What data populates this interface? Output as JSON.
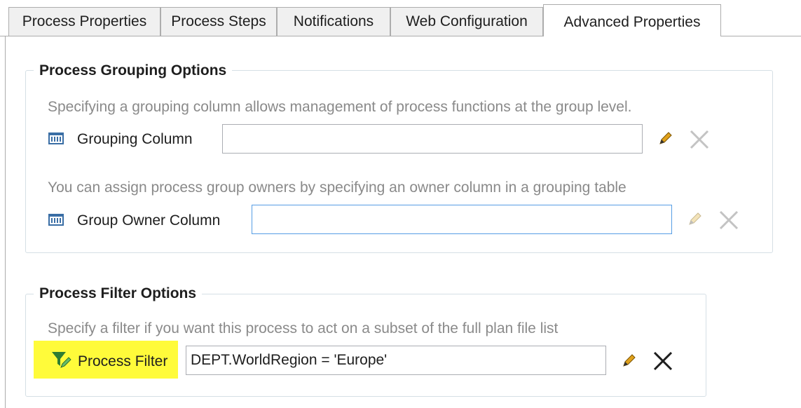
{
  "tabs": [
    {
      "label": "Process Properties"
    },
    {
      "label": "Process Steps"
    },
    {
      "label": "Notifications"
    },
    {
      "label": "Web Configuration"
    },
    {
      "label": "Advanced Properties"
    }
  ],
  "active_tab": "Advanced Properties",
  "grouping": {
    "title": "Process Grouping Options",
    "hint1": "Specifying a grouping column allows management of process functions at the group level.",
    "grouping_column_label": "Grouping Column",
    "grouping_column_value": "",
    "hint2": "You can assign process group owners by specifying an owner column in a grouping table",
    "owner_column_label": "Group Owner Column",
    "owner_column_value": ""
  },
  "filter": {
    "title": "Process Filter Options",
    "hint": "Specify a filter if you want this process to act on a subset of the full plan file list",
    "label": "Process Filter",
    "value": "DEPT.WorldRegion = 'Europe'"
  },
  "icons": {
    "column": "table-column-icon",
    "filter": "filter-edit-icon",
    "edit": "pencil-icon",
    "clear": "close-icon"
  },
  "colors": {
    "highlight": "#fffb3a",
    "filter_icon": "#2e7d32",
    "pencil_body": "#e0a11b",
    "column_icon": "#3a6ea5"
  }
}
